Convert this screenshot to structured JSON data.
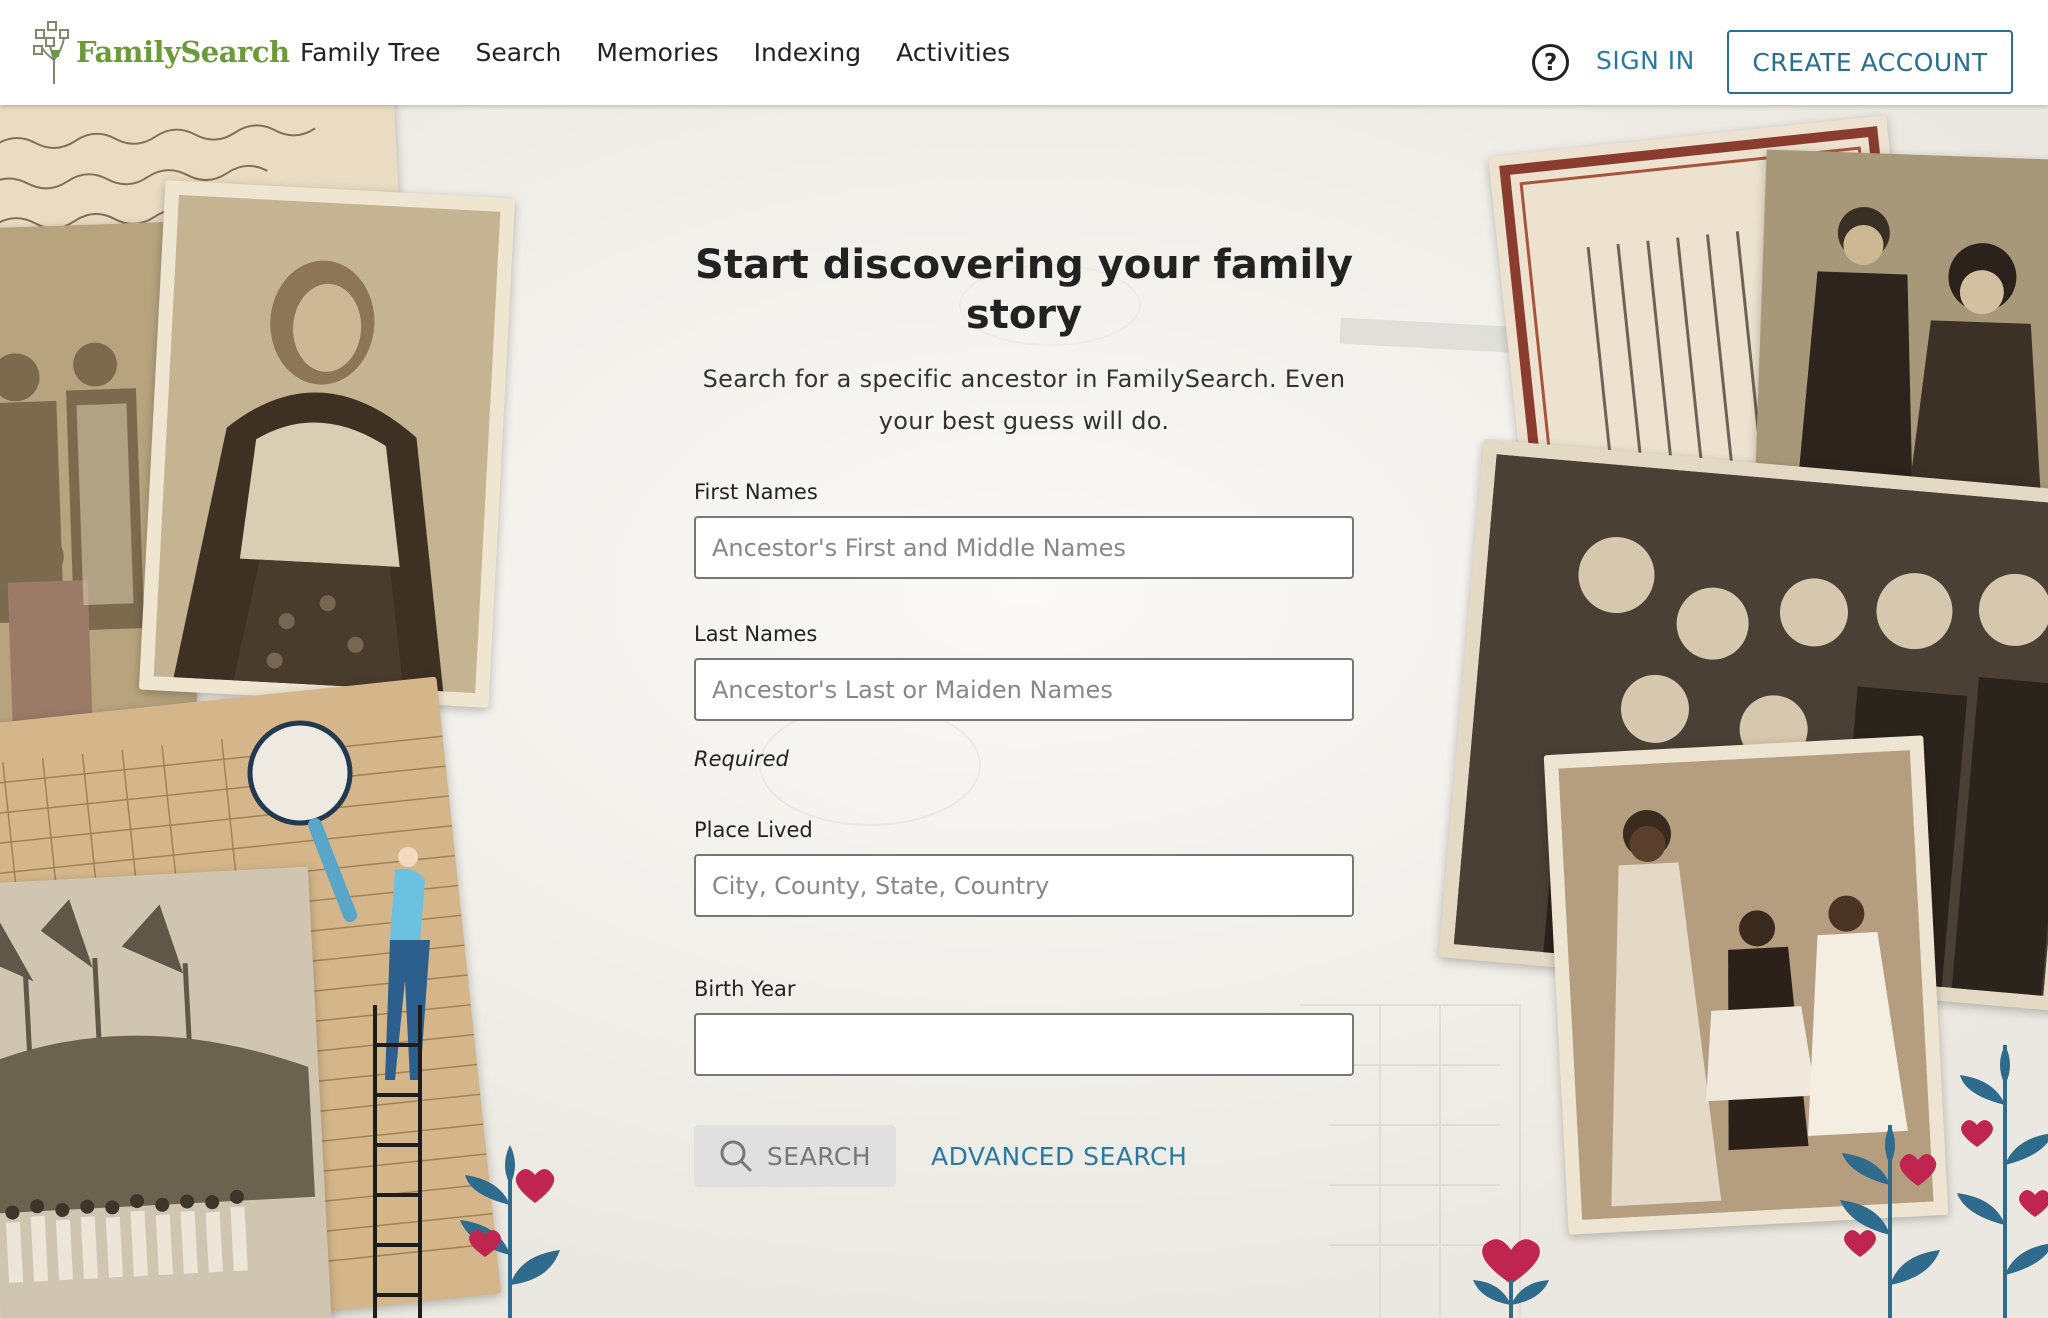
{
  "brand": {
    "name": "FamilySearch"
  },
  "nav": {
    "items": [
      {
        "label": "Family Tree"
      },
      {
        "label": "Search"
      },
      {
        "label": "Memories"
      },
      {
        "label": "Indexing"
      },
      {
        "label": "Activities"
      }
    ]
  },
  "header_actions": {
    "help_glyph": "?",
    "sign_in": "SIGN IN",
    "create_account": "CREATE ACCOUNT"
  },
  "hero": {
    "title": "Start discovering your family story",
    "subtitle": "Search for a specific ancestor in FamilySearch. Even your best guess will do."
  },
  "form": {
    "first_names": {
      "label": "First Names",
      "placeholder": "Ancestor's First and Middle Names",
      "value": ""
    },
    "last_names": {
      "label": "Last Names",
      "placeholder": "Ancestor's Last or Maiden Names",
      "value": ""
    },
    "required_note": "Required",
    "place_lived": {
      "label": "Place Lived",
      "placeholder": "City, County, State, Country",
      "value": ""
    },
    "birth_year": {
      "label": "Birth Year",
      "placeholder": "",
      "value": ""
    },
    "search_button": "SEARCH",
    "advanced_search": "ADVANCED SEARCH"
  },
  "colors": {
    "brand_green": "#6c9a3a",
    "link_blue": "#2a7aa0",
    "button_border": "#2a6f8f",
    "leaf_blue": "#2f6b8c",
    "heart_pink": "#c0254f"
  },
  "icons": [
    "family-tree-logo-icon",
    "help-icon",
    "search-icon",
    "magnifying-glass-illustration",
    "heart-icon",
    "leaf-plant-icon"
  ]
}
